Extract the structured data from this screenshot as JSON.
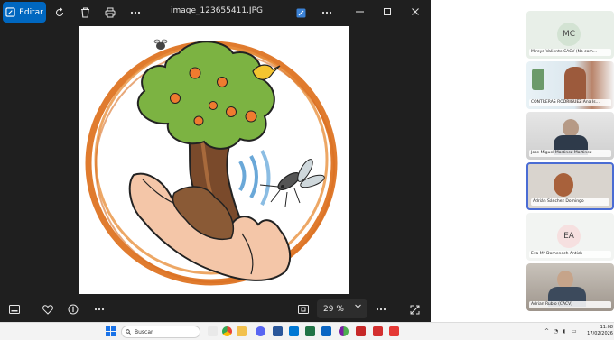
{
  "viewer": {
    "edit_label": "Editar",
    "filename": "image_123655411.JPG",
    "zoom": "29 %",
    "icons": [
      "edit-icon",
      "rotate-icon",
      "delete-icon",
      "print-icon",
      "more-icon",
      "enhance-icon",
      "more-icon",
      "minimize-icon",
      "maximize-icon",
      "close-icon",
      "filmstrip-icon",
      "favorite-icon",
      "info-icon",
      "more-icon",
      "fit-icon",
      "chevron-down-icon",
      "more-icon",
      "fullscreen-icon"
    ]
  },
  "participants": [
    {
      "initials": "MC",
      "name": "Mireya Valiente CACV (No com...",
      "type": "avatar",
      "bg": "#e8efe8"
    },
    {
      "initials": "",
      "name": "CONTRERAS RODRIGUEZ Ana Is...",
      "type": "video"
    },
    {
      "initials": "",
      "name": "Jose Miguel Martinez Martinez",
      "type": "video"
    },
    {
      "initials": "",
      "name": "Adrián Sánchez Domingo",
      "type": "video"
    },
    {
      "initials": "EA",
      "name": "Eva Mª Domenech Antich",
      "type": "avatar",
      "bg": "#f6e7e7"
    },
    {
      "initials": "",
      "name": "Adrian Rubio (CACV)",
      "type": "video"
    }
  ],
  "taskbar": {
    "search_placeholder": "Buscar",
    "time": "11:08",
    "date": "17/02/2026"
  },
  "colors": {
    "accent": "#0067c0",
    "viewer_bg": "#1f1f1f",
    "orange": "#e07b2e",
    "leaf_green": "#7cb342"
  }
}
